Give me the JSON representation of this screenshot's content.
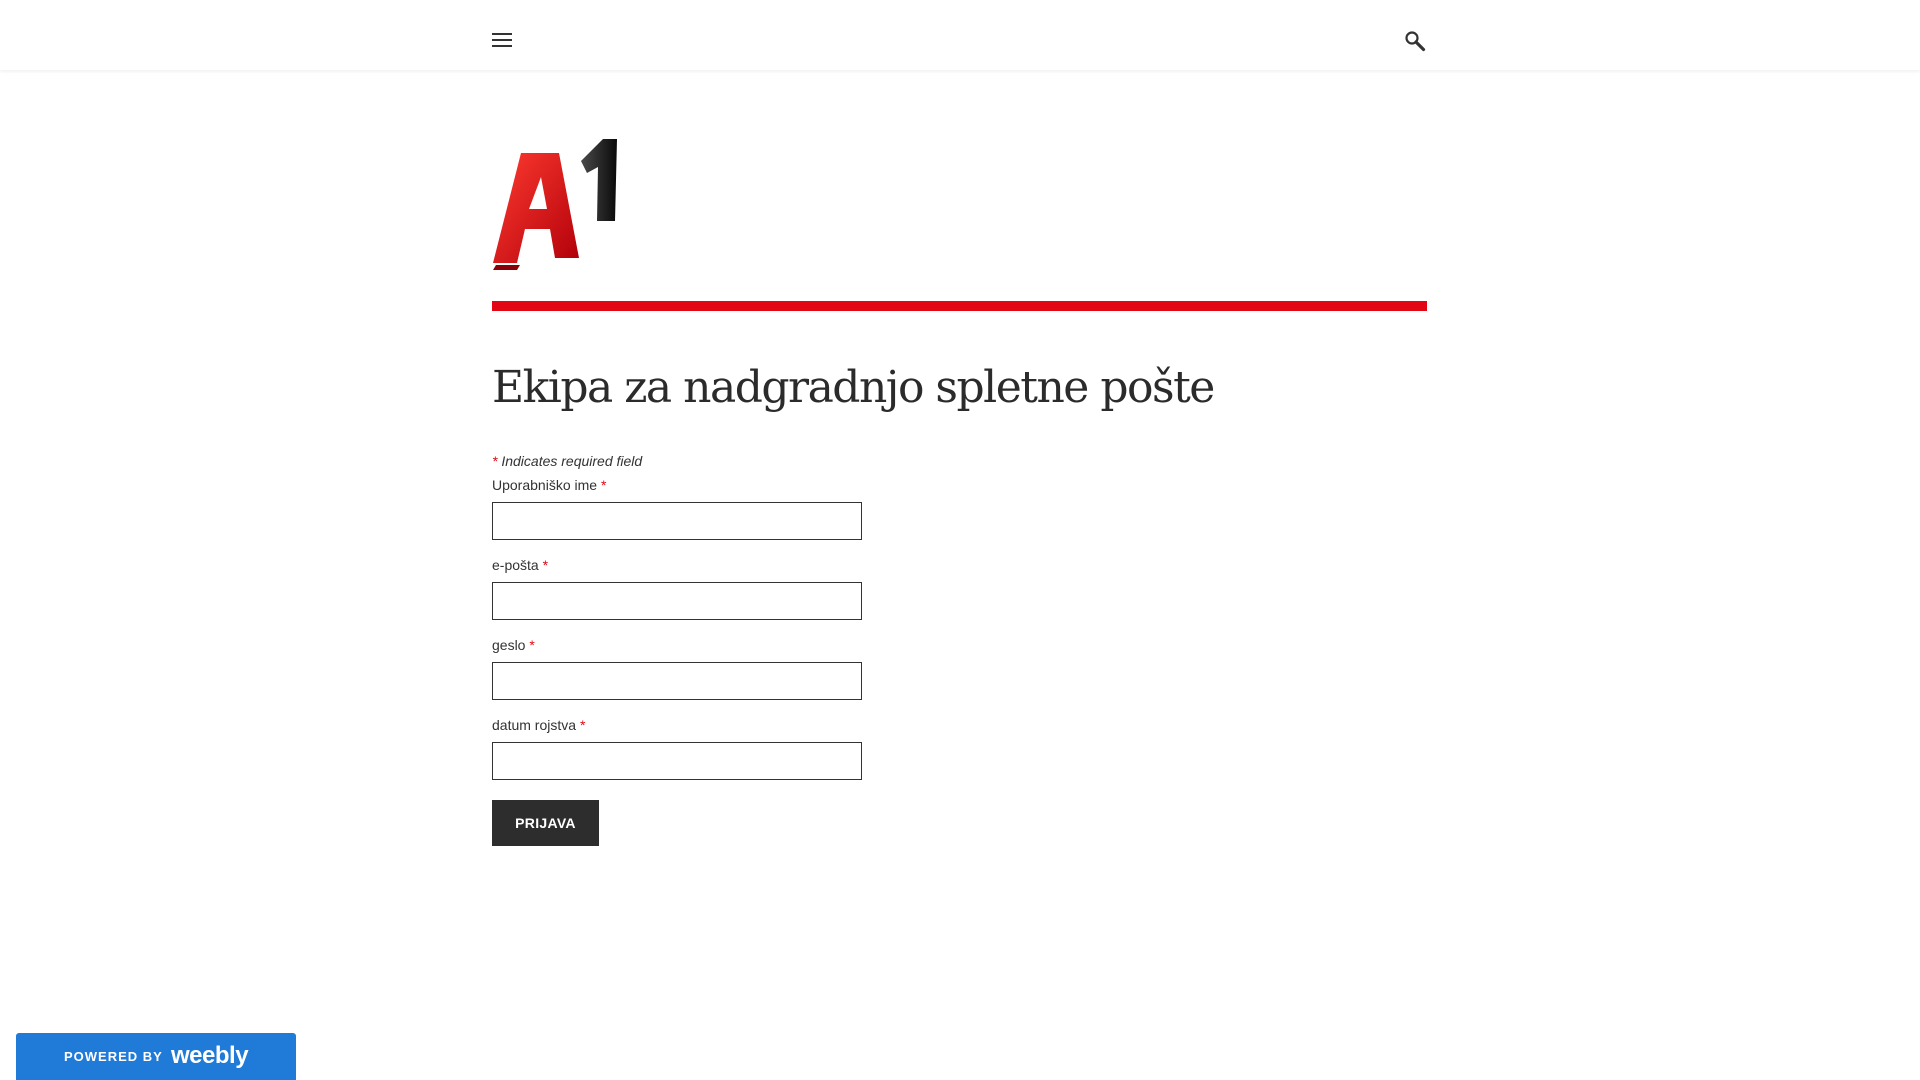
{
  "header": {
    "menu_icon": "hamburger-icon",
    "search_icon": "search-icon"
  },
  "logo": {
    "text": "A1",
    "colors": {
      "letter": "#e30613",
      "digit": "#1a1a1a"
    }
  },
  "accent_color": "#e30613",
  "page_title": "Ekipa za nadgradnjo spletne pošte",
  "form": {
    "required_marker": "*",
    "required_note": "Indicates required field",
    "fields": [
      {
        "label": "Uporabniško ime",
        "value": "",
        "placeholder": ""
      },
      {
        "label": "e-pošta",
        "value": "",
        "placeholder": ""
      },
      {
        "label": "geslo",
        "value": "",
        "placeholder": ""
      },
      {
        "label": "datum rojstva",
        "value": "",
        "placeholder": ""
      }
    ],
    "submit_label": "PRIJAVA"
  },
  "footer": {
    "powered_by": "POWERED BY",
    "brand": "weebly",
    "brand_color": "#1f7ad8"
  }
}
